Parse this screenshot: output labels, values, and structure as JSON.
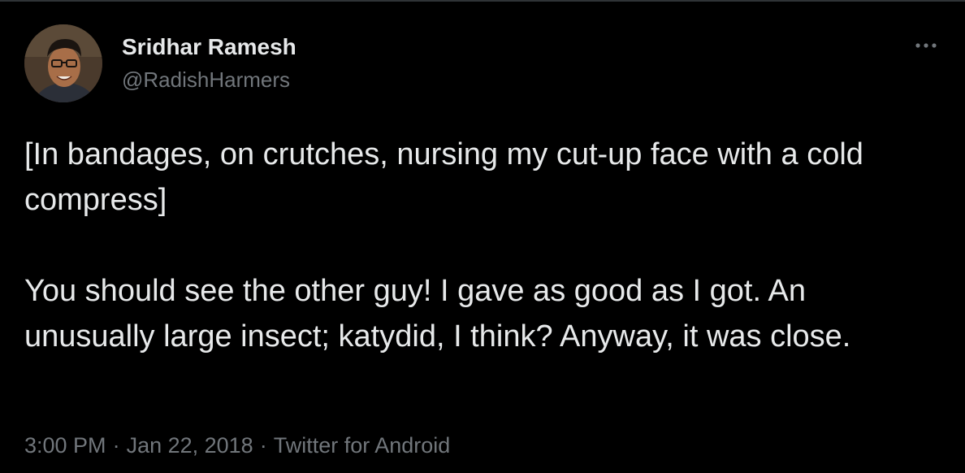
{
  "author": {
    "display_name": "Sridhar Ramesh",
    "handle": "@RadishHarmers"
  },
  "tweet": {
    "paragraphs": [
      "[In bandages, on crutches, nursing my cut-up face with a cold compress]",
      "You should see the other guy! I gave as good as I got. An unusually large insect; katydid, I think? Anyway, it was close."
    ]
  },
  "meta": {
    "time": "3:00 PM",
    "separator": "·",
    "date": "Jan 22, 2018",
    "source": "Twitter for Android"
  },
  "icons": {
    "more": "more-horizontal-icon"
  },
  "colors": {
    "background": "#000000",
    "text_primary": "#e7e9ea",
    "text_secondary": "#71767b"
  }
}
